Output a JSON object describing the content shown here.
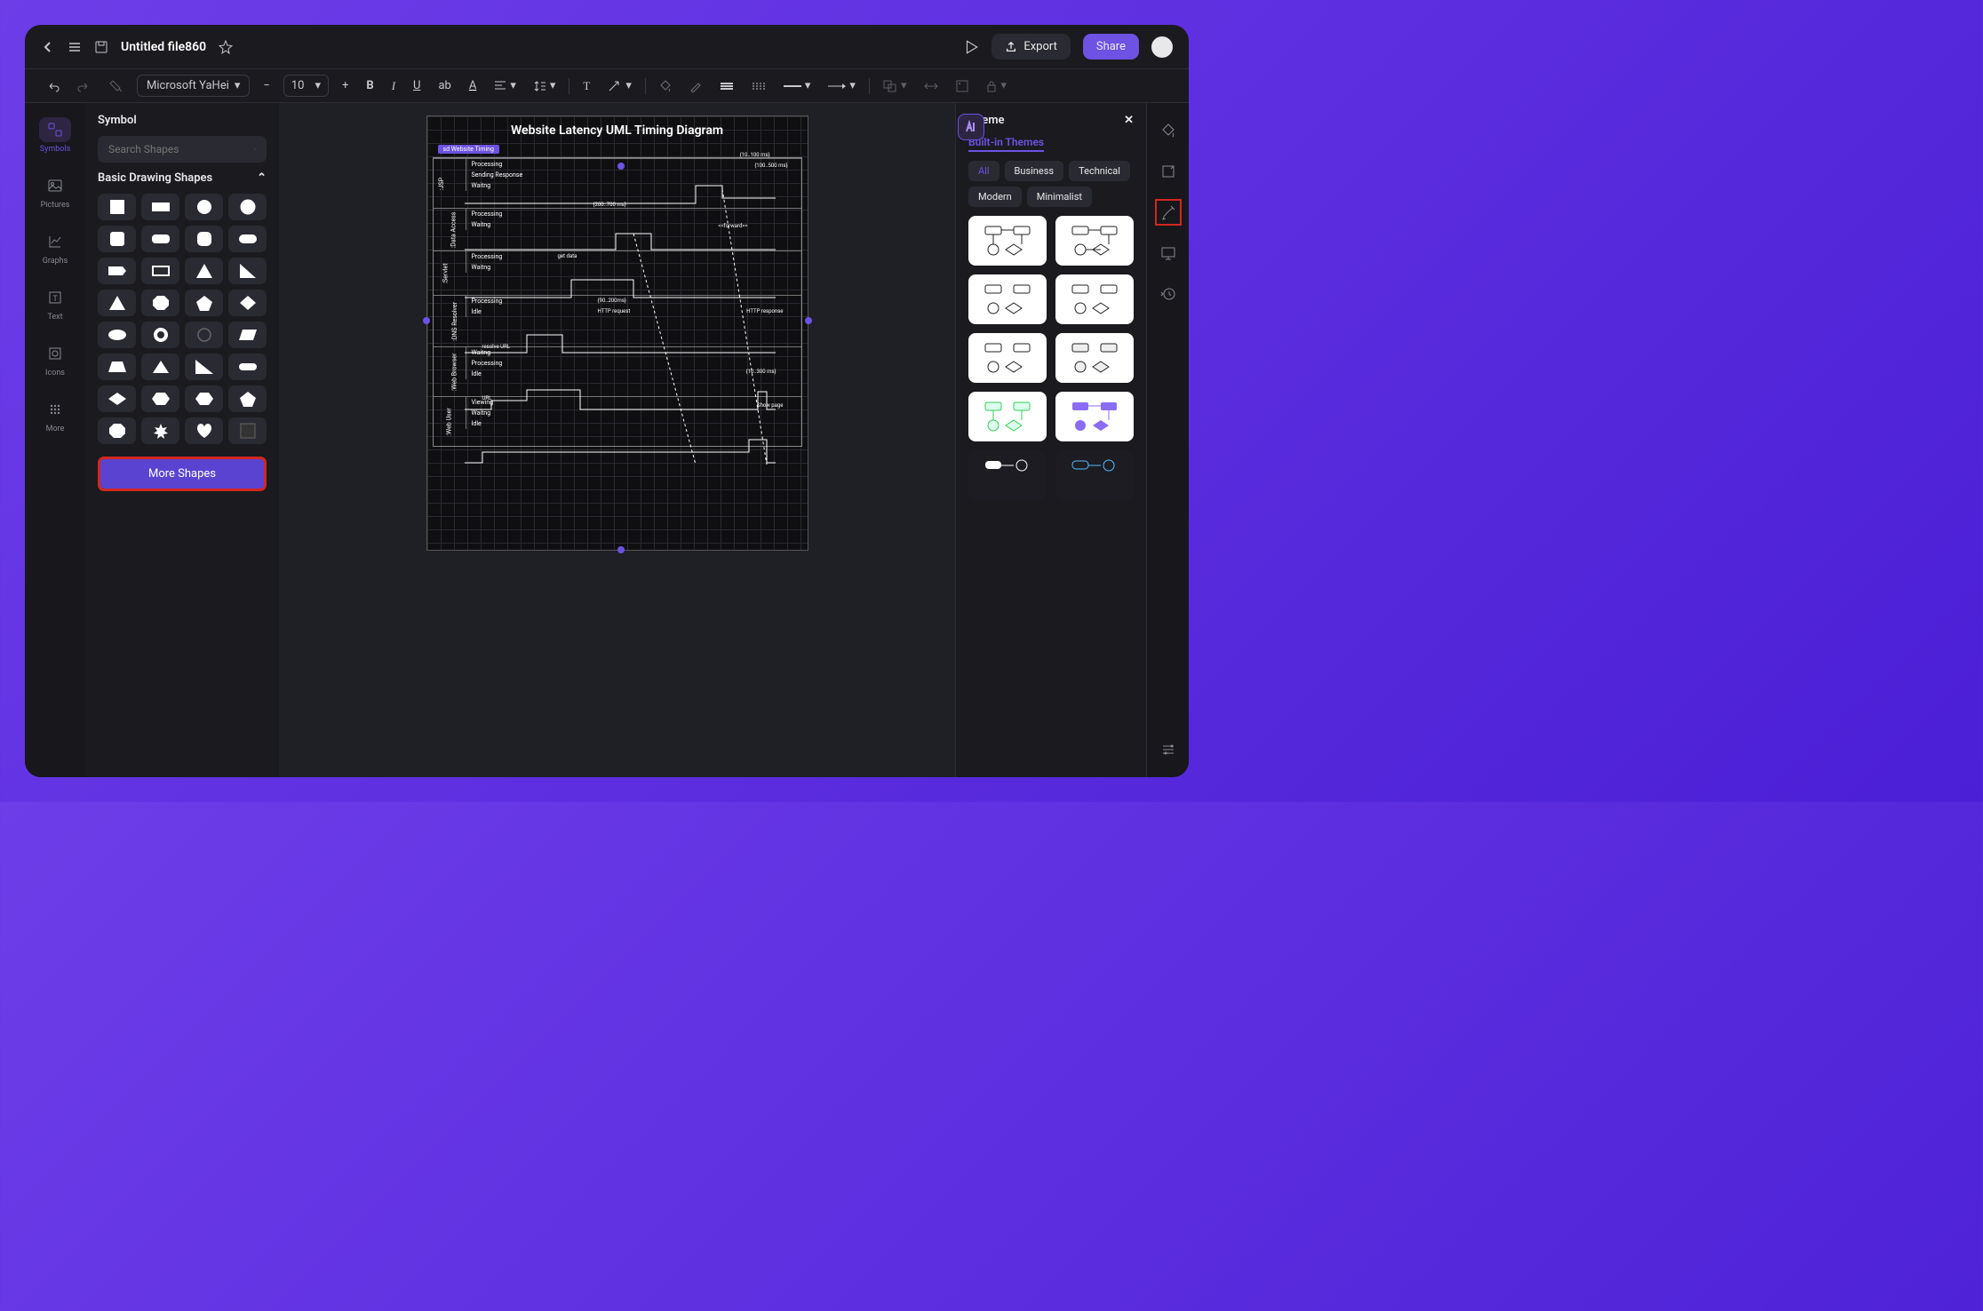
{
  "topbar": {
    "title": "Untitled file860",
    "export": "Export",
    "share": "Share"
  },
  "toolbar": {
    "font": "Microsoft YaHei",
    "size": "10"
  },
  "sidenav": [
    {
      "label": "Symbols",
      "icon": "symbols"
    },
    {
      "label": "Pictures",
      "icon": "pictures"
    },
    {
      "label": "Graphs",
      "icon": "graphs"
    },
    {
      "label": "Text",
      "icon": "text"
    },
    {
      "label": "Icons",
      "icon": "icons"
    },
    {
      "label": "More",
      "icon": "more"
    }
  ],
  "symbol": {
    "heading": "Symbol",
    "search_placeholder": "Search Shapes",
    "group": "Basic Drawing Shapes",
    "more": "More Shapes"
  },
  "diagram": {
    "title": "Website Latency UML Timing Diagram",
    "sd_label": "sd Website Timing",
    "lanes": [
      {
        "name": ":JSP",
        "states": [
          "Processing",
          "Sending Response",
          "Waitng"
        ]
      },
      {
        "name": ":Data Access",
        "states": [
          "Processing",
          "Waitng"
        ]
      },
      {
        "name": ":Servlet",
        "states": [
          "Processing",
          "Waitng"
        ]
      },
      {
        "name": ":DNS Resolver",
        "states": [
          "Processing",
          "Idle"
        ]
      },
      {
        "name": ":Web Browser",
        "states": [
          "Waitng",
          "Processing",
          "Idle"
        ]
      },
      {
        "name": ":Web User",
        "states": [
          "Viewing",
          "Waitng",
          "Idle"
        ]
      }
    ],
    "annotations": {
      "t1": "{10..100 ms}",
      "t2": "{100..500 ms}",
      "t3": "{200..700 ms}",
      "t4": "{90..200ms}",
      "t5": "{10..300 ms}",
      "getdata": "get data",
      "forward": "<<forward>>",
      "httpreq": "HTTP request",
      "httpres": "HTTP response",
      "resolve": "resolve URL",
      "url": "URL",
      "showpage": "Show page"
    }
  },
  "theme": {
    "heading": "Theme",
    "sub": "Built-in Themes",
    "tags": [
      "All",
      "Business",
      "Technical",
      "Modern",
      "Minimalist"
    ]
  }
}
